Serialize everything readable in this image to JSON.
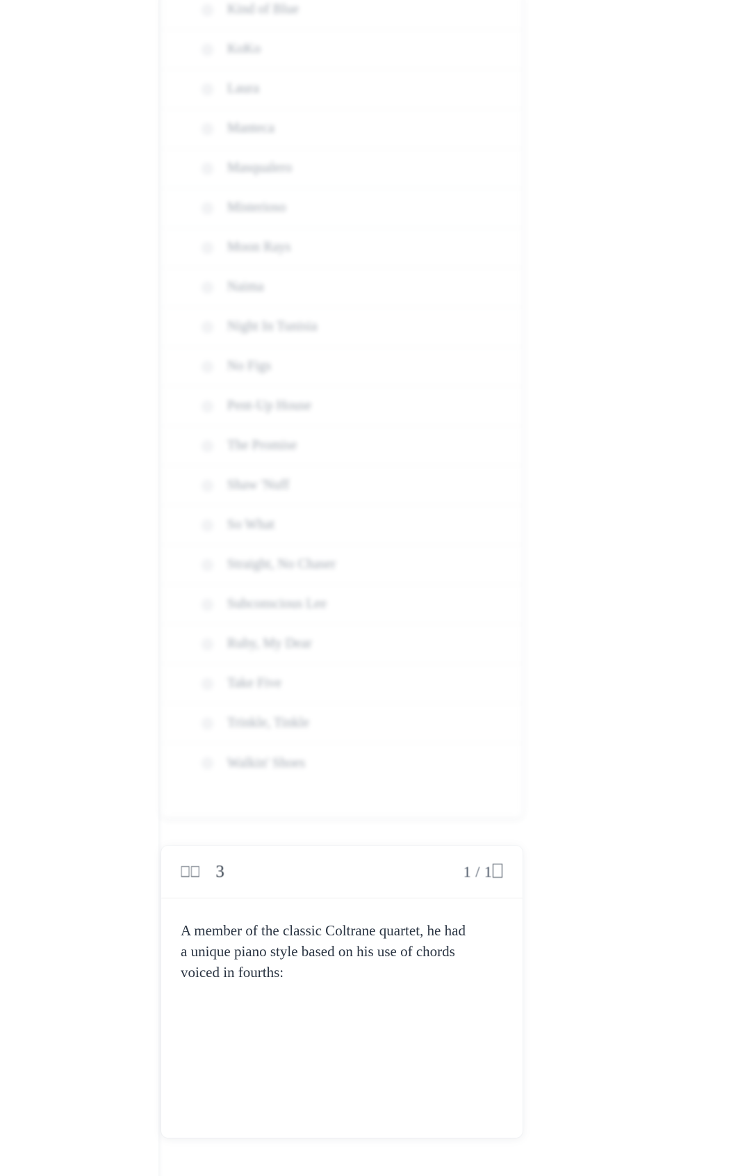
{
  "options_card": {
    "name": "answer-options-list",
    "items": [
      {
        "label": "Kind of Blue",
        "selected": false
      },
      {
        "label": "KoKo",
        "selected": false
      },
      {
        "label": "Laura",
        "selected": false
      },
      {
        "label": "Manteca",
        "selected": false
      },
      {
        "label": "Masqualero",
        "selected": false
      },
      {
        "label": "Misterioso",
        "selected": false
      },
      {
        "label": "Moon Rays",
        "selected": false
      },
      {
        "label": "Naima",
        "selected": false
      },
      {
        "label": "Night In Tunisia",
        "selected": false
      },
      {
        "label": "No Figs",
        "selected": false
      },
      {
        "label": "Pent-Up House",
        "selected": false
      },
      {
        "label": "The Promise",
        "selected": false
      },
      {
        "label": "Shaw 'Nuff",
        "selected": false
      },
      {
        "label": "So What",
        "selected": false
      },
      {
        "label": "Straight, No Chaser",
        "selected": false
      },
      {
        "label": "Subconscious Lee",
        "selected": false
      },
      {
        "label": "Ruby, My Dear",
        "selected": false
      },
      {
        "label": "Take Five",
        "selected": false
      },
      {
        "label": "Trinkle, Tinkle",
        "selected": false
      },
      {
        "label": "Walkin' Shoes",
        "selected": false
      }
    ]
  },
  "question_card": {
    "header": {
      "prefix_glyphs": "⎕⎕",
      "number": "3",
      "counter_text": "1 / 1",
      "counter_trailing_glyph": "⎕"
    },
    "question_text": "A member of the classic Coltrane quartet, he had a unique piano style based on his use of chords voiced in fourths:"
  },
  "colors": {
    "page_background": "#ffffff",
    "card_background": "#ffffff",
    "option_text": "#9aa1ab",
    "question_text": "#2a3442",
    "divider": "#f3f4f6",
    "radio_fill": "#f2f3f5"
  }
}
